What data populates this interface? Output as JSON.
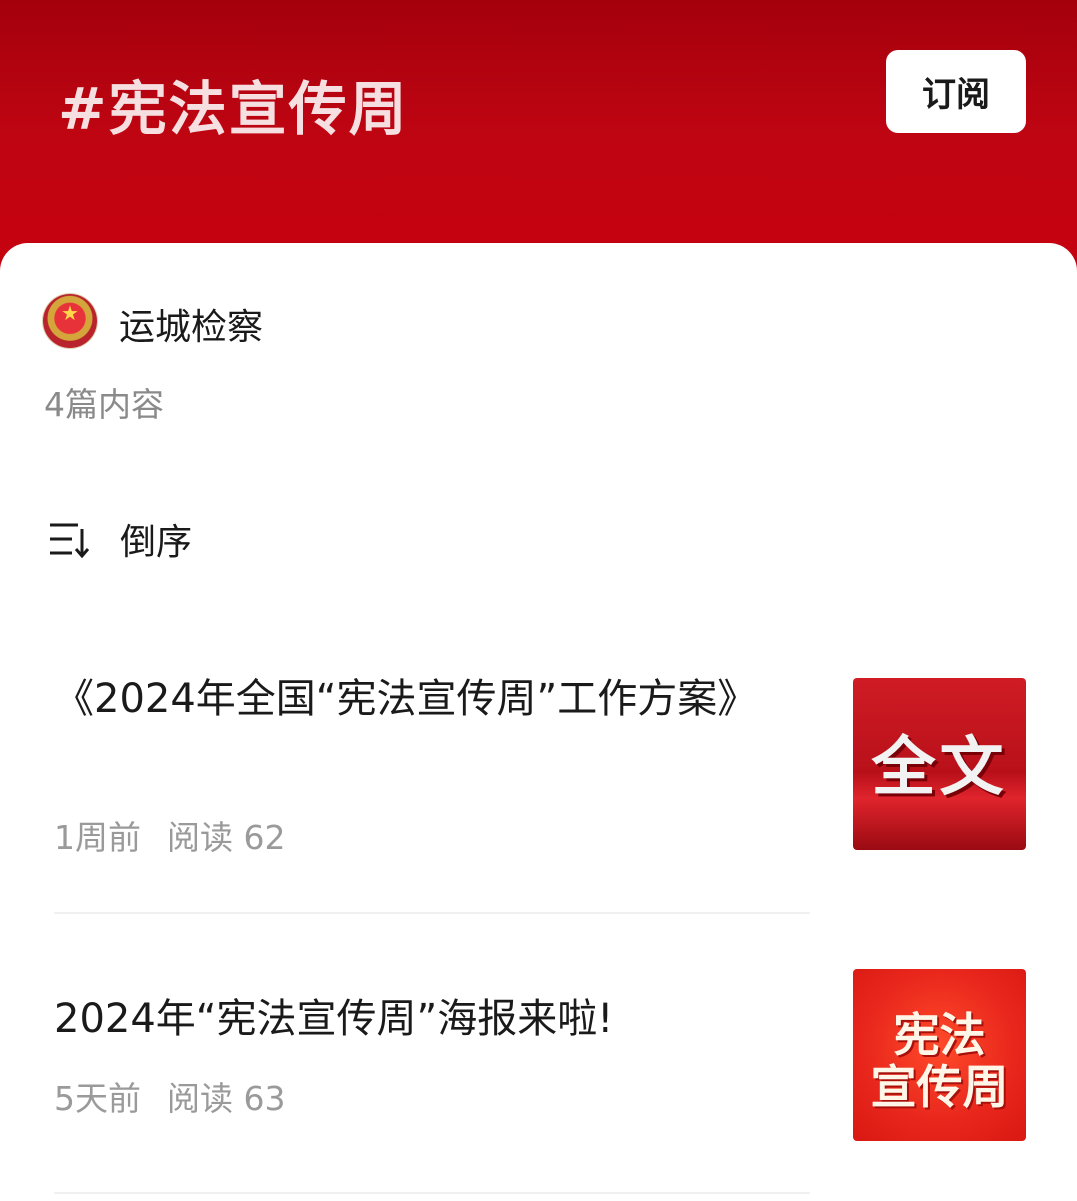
{
  "header": {
    "title": "#宪法宣传周",
    "subscribe_label": "订阅"
  },
  "account": {
    "name": "运城检察",
    "count": "4篇内容"
  },
  "sort": {
    "label": "倒序",
    "icon": "sort-descending-icon"
  },
  "articles": [
    {
      "title": "《2024年全国“宪法宣传周”工作方案》",
      "time": "1周前",
      "reads": "阅读 62",
      "thumb_text": "全文"
    },
    {
      "title": "2024年“宪法宣传周”海报来啦!",
      "time": "5天前",
      "reads": "阅读 63",
      "thumb_line1": "宪法",
      "thumb_line2": "宣传周"
    }
  ],
  "colors": {
    "header_red": "#c8000e",
    "meta_gray": "#9a9a9a"
  }
}
